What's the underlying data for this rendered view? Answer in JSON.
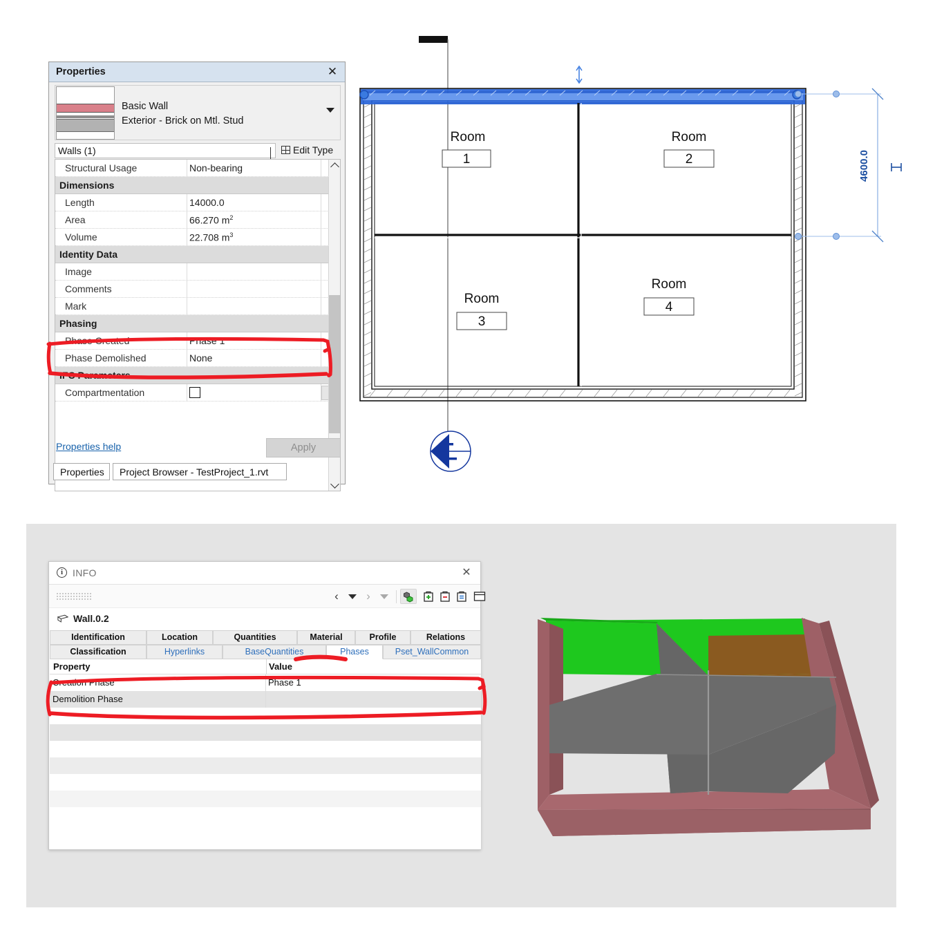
{
  "properties_palette": {
    "title": "Properties",
    "close_icon": "close-icon",
    "type_selector": {
      "family": "Basic Wall",
      "type": "Exterior - Brick on Mtl. Stud",
      "dropdown_icon": "caret-down-icon"
    },
    "category": "Walls (1)",
    "edit_type_label": "Edit Type",
    "parameters": [
      {
        "kind": "row",
        "name": "Structural Usage",
        "value": "Non-bearing"
      },
      {
        "kind": "group",
        "name": "Dimensions"
      },
      {
        "kind": "row",
        "name": "Length",
        "value": "14000.0"
      },
      {
        "kind": "row",
        "name": "Area",
        "value": "66.270 m",
        "sup": "2"
      },
      {
        "kind": "row",
        "name": "Volume",
        "value": "22.708 m",
        "sup": "3"
      },
      {
        "kind": "group",
        "name": "Identity Data"
      },
      {
        "kind": "row",
        "name": "Image",
        "value": ""
      },
      {
        "kind": "row",
        "name": "Comments",
        "value": ""
      },
      {
        "kind": "row",
        "name": "Mark",
        "value": ""
      },
      {
        "kind": "group",
        "name": "Phasing"
      },
      {
        "kind": "row",
        "name": "Phase Created",
        "value": "Phase 1",
        "highlighted": true
      },
      {
        "kind": "row",
        "name": "Phase Demolished",
        "value": "None",
        "highlighted": true
      },
      {
        "kind": "group",
        "name": "IFC Parameters"
      },
      {
        "kind": "checkbox",
        "name": "Compartmentation",
        "checked": false
      }
    ],
    "help_link": "Properties help",
    "apply_button": "Apply",
    "tabs": [
      {
        "label": "Properties",
        "active": true
      },
      {
        "label": "Project Browser - TestProject_1.rvt",
        "active": false
      }
    ]
  },
  "floor_plan": {
    "rooms": [
      {
        "label": "Room",
        "number": "1"
      },
      {
        "label": "Room",
        "number": "2"
      },
      {
        "label": "Room",
        "number": "3"
      },
      {
        "label": "Room",
        "number": "4"
      }
    ],
    "dimension": {
      "value": "4600.0",
      "color": "#1c4fa1"
    },
    "selected_wall_color": "#2864d8",
    "section_marker_color": "#14379e",
    "grid_line_color": "#5a5a5a"
  },
  "info_dialog": {
    "title": "INFO",
    "info_icon": "info-circle-icon",
    "close_icon": "close-icon",
    "toolbar": {
      "prev_icon": "chevron-left-icon",
      "prev_menu_icon": "caret-down-icon",
      "next_icon": "chevron-right-icon",
      "next_menu_icon": "caret-down-icon",
      "cubes_icon": "cubes-icon",
      "add_icon": "add-property-icon",
      "remove_icon": "remove-property-icon",
      "edit_icon": "edit-property-icon",
      "panel_icon": "panel-layout-icon"
    },
    "entity": {
      "icon": "wall-icon",
      "name": "Wall.0.2"
    },
    "tabs_row1": [
      {
        "label": "Identification",
        "style": "bold"
      },
      {
        "label": "Location",
        "style": "bold"
      },
      {
        "label": "Quantities",
        "style": "bold"
      },
      {
        "label": "Material",
        "style": "bold"
      },
      {
        "label": "Profile",
        "style": "bold"
      },
      {
        "label": "Relations",
        "style": "bold"
      }
    ],
    "tabs_row2": [
      {
        "label": "Classification",
        "style": "bold"
      },
      {
        "label": "Hyperlinks",
        "style": "link"
      },
      {
        "label": "BaseQuantities",
        "style": "link"
      },
      {
        "label": "Phases",
        "style": "active"
      },
      {
        "label": "Pset_WallCommon",
        "style": "link"
      }
    ],
    "table": {
      "headers": [
        "Property",
        "Value"
      ],
      "rows": [
        {
          "property": "Creation Phase",
          "value": "Phase 1",
          "highlighted": true
        },
        {
          "property": "Demolition Phase",
          "value": "",
          "highlighted": true
        }
      ]
    }
  },
  "model_3d": {
    "background_color": "#e4e4e4",
    "wall_color": "#9e6066",
    "roof_green_color": "#1ec81e",
    "roof_brown_color": "#8a5a20",
    "partition_color": "#6e6e6e"
  },
  "annotations": {
    "color": "#ed1c24",
    "marks": [
      {
        "target": "properties-phasing-rows"
      },
      {
        "target": "info-phases-tab"
      },
      {
        "target": "info-phase-rows"
      }
    ]
  }
}
